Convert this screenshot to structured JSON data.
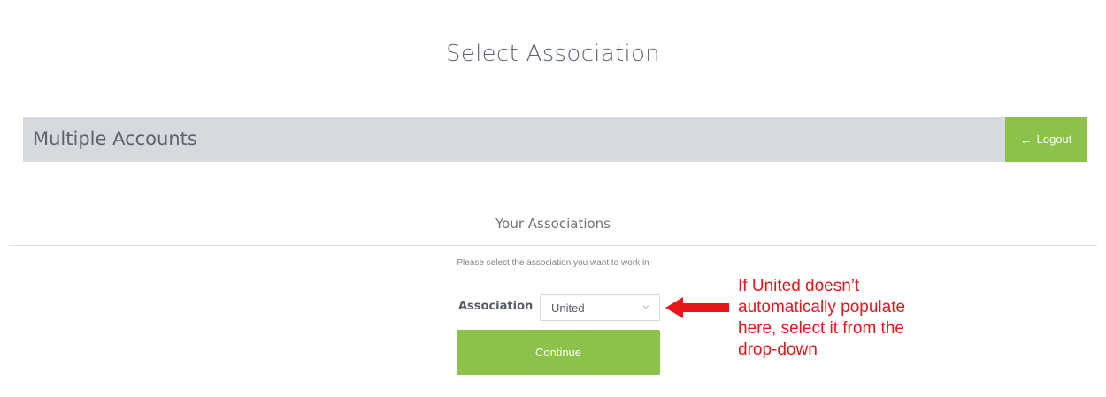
{
  "page": {
    "title": "Select Association"
  },
  "header": {
    "title": "Multiple Accounts",
    "logout_label": "Logout",
    "logout_icon": "arrow-left-icon"
  },
  "section": {
    "title": "Your Associations",
    "instruction": "Please select the association you want to work in"
  },
  "form": {
    "association_label": "Association",
    "association_selected": "United",
    "continue_label": "Continue"
  },
  "annotation": {
    "lines": [
      "If United doesn’t",
      "automatically populate",
      "here, select it from the",
      "drop-down"
    ],
    "color": "#e8151b"
  },
  "colors": {
    "accent_green": "#8bc34a",
    "header_bar": "#d6d9de",
    "text_gray": "#5b6570"
  }
}
